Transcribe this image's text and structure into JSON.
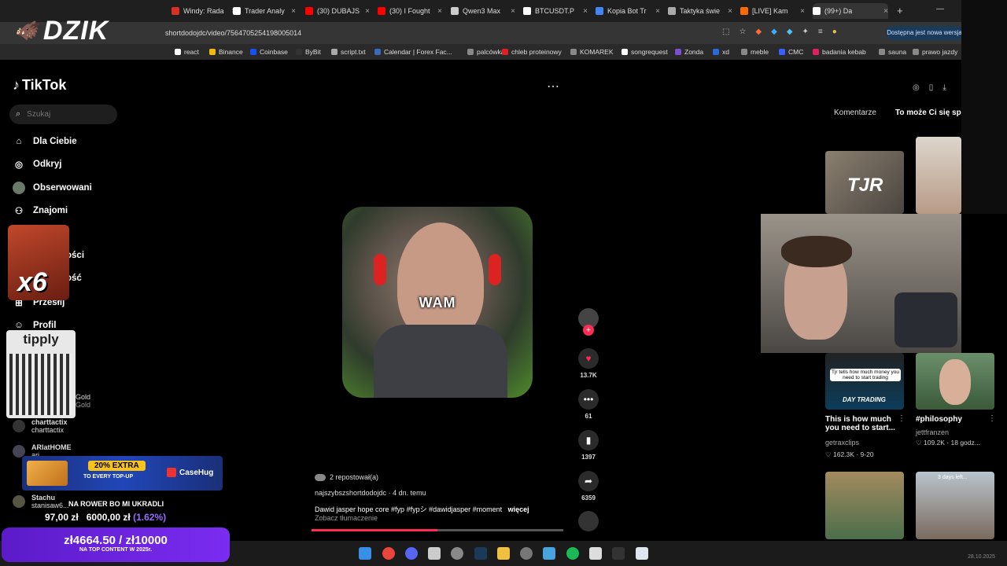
{
  "browser": {
    "tabs": [
      {
        "label": "Windy: Rada",
        "color": "#d93025"
      },
      {
        "label": "Trader Analy",
        "color": "#ffffff"
      },
      {
        "label": "(30) DUBAJS",
        "color": "#ff0000"
      },
      {
        "label": "(30) I Fought",
        "color": "#ff0000"
      },
      {
        "label": "Qwen3 Max",
        "color": "#cccccc"
      },
      {
        "label": "BTCUSDT.P",
        "color": "#ffffff"
      },
      {
        "label": "Kopia Bot Tr",
        "color": "#4285f4"
      },
      {
        "label": "Taktyka świe",
        "color": "#aaaaaa"
      },
      {
        "label": "[LIVE] Kam",
        "color": "#ff6a00"
      },
      {
        "label": "(99+) Da",
        "color": "#ffffff"
      }
    ],
    "new_tab": "+",
    "url": "shortdodojdc/video/7564705254198005014",
    "update_label": "Dostępna jest nowa wersja",
    "bookmarks": [
      {
        "label": "react",
        "color": "#ffffff"
      },
      {
        "label": "Binance",
        "color": "#f0b90b"
      },
      {
        "label": "Coinbase",
        "color": "#1652f0"
      },
      {
        "label": "ByBit",
        "color": "#333333"
      },
      {
        "label": "script.txt",
        "color": "#aaaaaa"
      },
      {
        "label": "Calendar | Forex Fac...",
        "color": "#3b6bbd"
      },
      {
        "label": "palcówka",
        "color": "#888888"
      },
      {
        "label": "chleb proteinowy",
        "color": "#e02020"
      },
      {
        "label": "KOMAREK",
        "color": "#888888"
      },
      {
        "label": "songrequest",
        "color": "#ffffff"
      },
      {
        "label": "Zonda",
        "color": "#7a4fd0"
      },
      {
        "label": "xd",
        "color": "#2a6bd6"
      },
      {
        "label": "meble",
        "color": "#888888"
      },
      {
        "label": "CMC",
        "color": "#3861fb"
      },
      {
        "label": "badania kebab",
        "color": "#e02060"
      },
      {
        "label": "sauna",
        "color": "#888888"
      },
      {
        "label": "prawo jazdy",
        "color": "#888888"
      }
    ]
  },
  "sidebar": {
    "logo": "TikTok",
    "search_placeholder": "Szukaj",
    "items": [
      {
        "label": "Dla Ciebie",
        "icon": "home-icon"
      },
      {
        "label": "Odkryj",
        "icon": "compass-icon"
      },
      {
        "label": "Obserwowani",
        "icon": "avatar-icon"
      },
      {
        "label": "Znajomi",
        "icon": "friends-icon"
      },
      {
        "label": "Przesłij",
        "icon": "upload-icon"
      },
      {
        "label": "Profil",
        "icon": "profile-icon"
      }
    ],
    "partial_items": [
      "ości",
      "ość"
    ],
    "accounts": [
      {
        "name": "Gold",
        "handle": "Gold"
      },
      {
        "name": "charttactix",
        "handle": "charttactix"
      },
      {
        "name": "ARIatHOME",
        "handle": "ari..."
      },
      {
        "name": "Stachu",
        "handle": "stanisaw6..."
      }
    ]
  },
  "video": {
    "caption": "WAM",
    "repost_text": "2 repostował(a)",
    "author": "najszybszshortdodojdc",
    "age": "4 dn. temu",
    "description": "Dawid jasper hope core #fyp #fypシ #dawidjasper #moment",
    "more_label": "więcej",
    "translate": "Zobacz tłumaczenie",
    "progress": 0.5,
    "actions": {
      "likes": "13.7K",
      "comments": "61",
      "saves": "1397",
      "shares": "6359"
    }
  },
  "right_panel": {
    "tabs": [
      "Komentarze",
      "To może Ci się spodobać"
    ],
    "cards": [
      {
        "title": "This is how much you need to start...",
        "author": "getraxclips",
        "likes": "162.3K",
        "date": "9-20",
        "overlay": "Tjr tells how much money you need to start trading",
        "tag": "DAY TRADING"
      },
      {
        "title": "#philosophy",
        "author": "jettfranzen",
        "likes": "109.2K",
        "date": "18 godz..."
      }
    ],
    "thumb_labels": [
      "TJR",
      "3 days left..."
    ]
  },
  "overlays": {
    "brand": "DZIK",
    "multiplier": "x6",
    "tipply": "tipply",
    "casehug_promo": "20% EXTRA",
    "casehug_sub": "TO EVERY TOP-UP",
    "casehug_brand": "CaseHug",
    "donation_message": "NA ROWER BO MI UKRADLI",
    "donation_amounts": "97,00 zł",
    "donation_amount_2": "6000,00 zł",
    "donation_pct": "(1.62%)",
    "goal_current": "zł4664.50 / zł10000",
    "goal_label": "NA TOP CONTENT W 2025r.",
    "date": "28.10.2025"
  }
}
